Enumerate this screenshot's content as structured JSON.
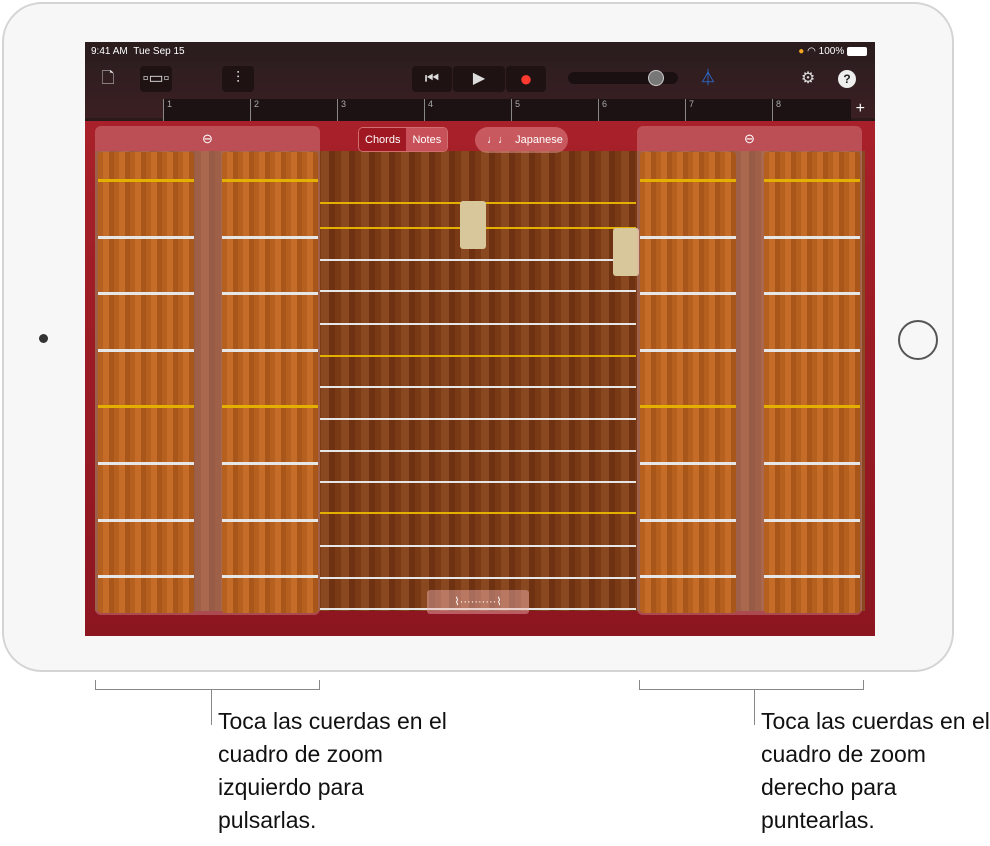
{
  "status": {
    "time": "9:41 AM",
    "date": "Tue Sep 15",
    "battery": "100%"
  },
  "toolbar": {
    "doc": "document-icon",
    "view": "view-icon",
    "mixer": "mixer-icon",
    "rewind": "⏮",
    "play": "▶",
    "record": "●",
    "metronome": "metronome-icon",
    "settings": "⚙",
    "help": "?",
    "volume": 0.85
  },
  "ruler": {
    "bars": [
      "1",
      "2",
      "3",
      "4",
      "5",
      "6",
      "7",
      "8"
    ],
    "add": "+"
  },
  "controls": {
    "chords": "Chords",
    "notes": "Notes",
    "scale": "Japanese",
    "scale_icon": "♩♩",
    "zoom_icon": "⊖",
    "vibrato": "⌇··········⌇"
  },
  "captions": {
    "left": "Toca las cuerdas en el cuadro de zoom izquierdo para pulsarlas.",
    "right": "Toca las cuerdas en el cuadro de zoom derecho para puntearlas."
  },
  "colors": {
    "accent": "#b81e2a",
    "record": "#ff3b30",
    "gold_string": "#e4b000"
  }
}
